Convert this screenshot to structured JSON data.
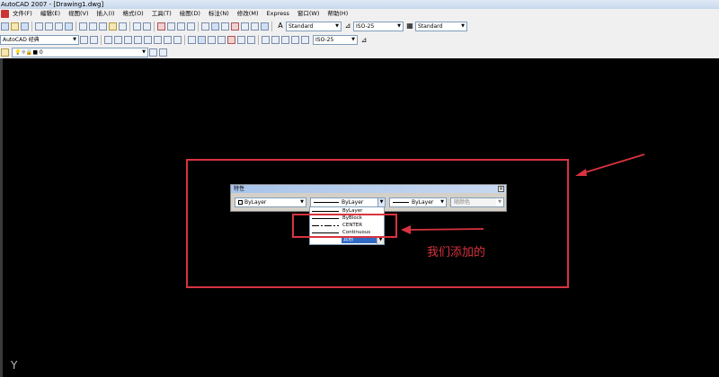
{
  "window": {
    "title": "AutoCAD 2007 - [Drawing1.dwg]"
  },
  "menu": [
    "文件(F)",
    "编辑(E)",
    "视图(V)",
    "插入(I)",
    "格式(O)",
    "工具(T)",
    "绘图(D)",
    "标注(N)",
    "修改(M)",
    "Express",
    "窗口(W)",
    "帮助(H)"
  ],
  "toolbar1": {
    "text_style": "Standard",
    "dim_style": "ISO-25",
    "table_style": "Standard"
  },
  "toolbar2": {
    "workspace": "AutoCAD 经典",
    "dim_style2": "ISO-25"
  },
  "toolbar3": {
    "layer_value": "0"
  },
  "properties_panel": {
    "title": "特性",
    "color": "ByLayer",
    "linetype": "ByLayer",
    "lineweight": "ByLayer",
    "plotstyle": "随颜色",
    "close": "×"
  },
  "linetype_dropdown": {
    "items": [
      "ByLayer",
      "ByBlock",
      "CENTER",
      "Continuous",
      "其他"
    ],
    "selected_index": 4
  },
  "annotation": {
    "text": "我们添加的"
  },
  "ucs_icon": "Y",
  "colors": {
    "highlight": "#d8333f",
    "canvas": "#000000",
    "selection": "#316ac5"
  }
}
